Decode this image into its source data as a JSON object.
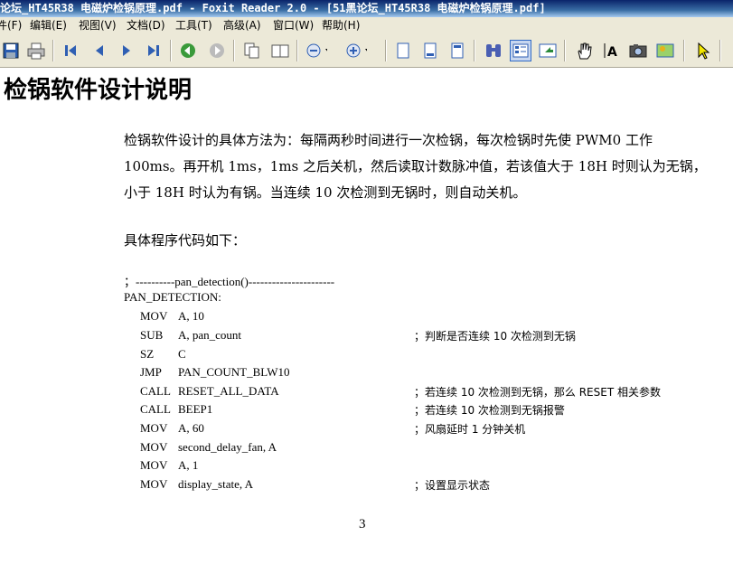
{
  "window": {
    "title": "论坛_HT45R38 电磁炉检锅原理.pdf - Foxit Reader 2.0 - [51黑论坛_HT45R38 电磁炉检锅原理.pdf]"
  },
  "menu": [
    "件(F)",
    "编辑(E)",
    "视图(V)",
    "文档(D)",
    "工具(T)",
    "高级(A)",
    "窗口(W)",
    "帮助(H)"
  ],
  "toolbar": {
    "icons": [
      "save-icon",
      "print-icon",
      "first-page-icon",
      "prev-page-icon",
      "next-page-icon",
      "last-page-icon",
      "go-back-icon",
      "go-forward-icon",
      "single-page-icon",
      "facing-pages-icon",
      "zoom-out-icon",
      "zoom-in-icon",
      "fit-page-icon",
      "fit-width-icon",
      "fit-visible-icon",
      "binoculars-icon",
      "thumbnail-icon",
      "export-icon",
      "hand-tool-icon",
      "text-select-icon",
      "snapshot-icon",
      "image-tool-icon",
      "select-arrow-icon"
    ]
  },
  "document": {
    "heading": "检锅软件设计说明",
    "paragraph_lines": [
      "检锅软件设计的具体方法为：每隔两秒时间进行一次检锅，每次检锅时先使  PWM0  工作",
      "100ms。再开机 1ms，1ms 之后关机，然后读取计数脉冲值，若该值大于 18H 时则认为无锅，",
      "小于 18H 时认为有锅。当连续 10 次检测到无锅时，则自动关机。"
    ],
    "code_intro": "具体程序代码如下：",
    "code_separator": "；----------pan_detection()----------------------",
    "code_label": "PAN_DETECTION:",
    "code_lines": [
      {
        "op": "MOV",
        "arg": "A, 10",
        "comment": ""
      },
      {
        "op": "SUB",
        "arg": "A, pan_count",
        "comment": "；判断是否连续 10 次检测到无锅"
      },
      {
        "op": "SZ",
        "arg": "C",
        "comment": ""
      },
      {
        "op": "JMP",
        "arg": "PAN_COUNT_BLW10",
        "comment": ""
      },
      {
        "op": "CALL",
        "arg": "RESET_ALL_DATA",
        "comment": "；若连续 10 次检测到无锅，那么 RESET 相关参数"
      },
      {
        "op": "CALL",
        "arg": "BEEP1",
        "comment": "；若连续 10 次检测到无锅报警"
      },
      {
        "op": "MOV",
        "arg": "A, 60",
        "comment": "；风扇延时 1 分钟关机"
      },
      {
        "op": "MOV",
        "arg": "second_delay_fan, A",
        "comment": ""
      },
      {
        "op": "MOV",
        "arg": "A, 1",
        "comment": ""
      },
      {
        "op": "MOV",
        "arg": "display_state, A",
        "comment": "；设置显示状态"
      }
    ],
    "page_number": "3"
  }
}
